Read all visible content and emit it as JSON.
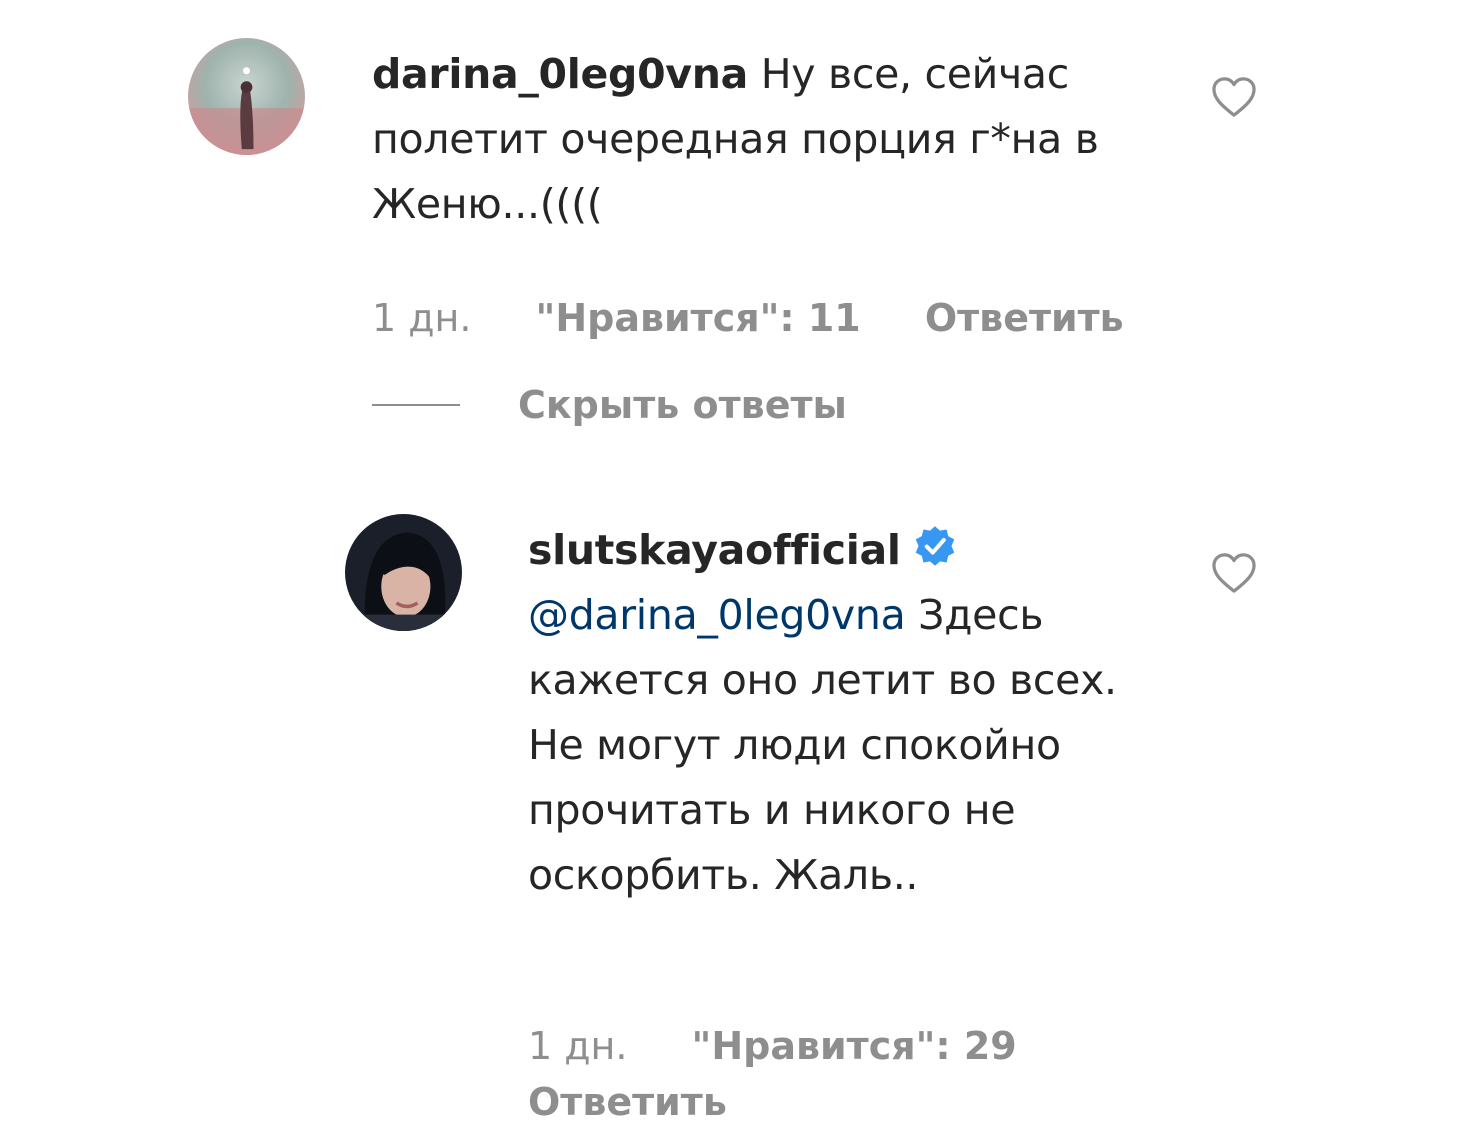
{
  "comments": [
    {
      "username": "darina_0leg0vna",
      "text": " Ну все, сейчас полетит очередная порция г*на в Женю...((((",
      "time": "1 дн.",
      "likes": "\"Нравится\": 11",
      "reply_label": "Ответить",
      "hide_replies_label": "Скрыть ответы"
    },
    {
      "username": "slutskayaofficial",
      "verified": true,
      "mention": "@darina_0leg0vna",
      "text": " Здесь кажется оно летит во всех. Не могут люди спокойно прочитать и никого не оскорбить. Жаль..",
      "time": "1 дн.",
      "likes": "\"Нравится\": 29",
      "reply_label": "Ответить"
    }
  ],
  "colors": {
    "text": "#262626",
    "muted": "#8e8e8e",
    "mention": "#00376b",
    "verified": "#3897f0"
  },
  "icons": {
    "like": "heart-outline-icon",
    "verified": "verified-badge-icon"
  }
}
